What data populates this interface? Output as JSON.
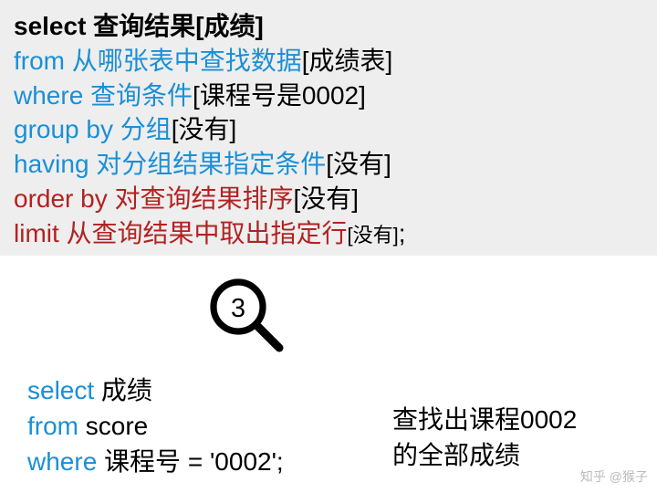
{
  "top": {
    "l1": {
      "kw": "select",
      "txt": " 查询结果",
      "br": "[成绩]"
    },
    "l2": {
      "kw": "from",
      "txt": " 从哪张表中查找数据",
      "br": "[成绩表]"
    },
    "l3": {
      "kw": "where",
      "txt": " 查询条件",
      "br": "[课程号是0002]"
    },
    "l4": {
      "kw": "group by",
      "txt": " 分组",
      "br": "[没有]"
    },
    "l5": {
      "kw": "having",
      "txt": " 对分组结果指定条件",
      "br": "[没有]"
    },
    "l6": {
      "kw": "order by",
      "txt": " 对查询结果排序",
      "br": "[没有]"
    },
    "l7": {
      "kw": "limit",
      "txt": " 从查询结果中取出指定行",
      "br": "[没有]",
      "tail": ";"
    }
  },
  "step_number": "3",
  "bottom": {
    "b1": {
      "kw": "select",
      "txt": " 成绩"
    },
    "b2": {
      "kw": "from",
      "txt": " score"
    },
    "b3": {
      "kw": "where",
      "txt": " 课程号 = '0002';"
    }
  },
  "right": {
    "r1": "查找出课程0002",
    "r2": "的全部成绩"
  },
  "watermark": "知乎 @猴子"
}
